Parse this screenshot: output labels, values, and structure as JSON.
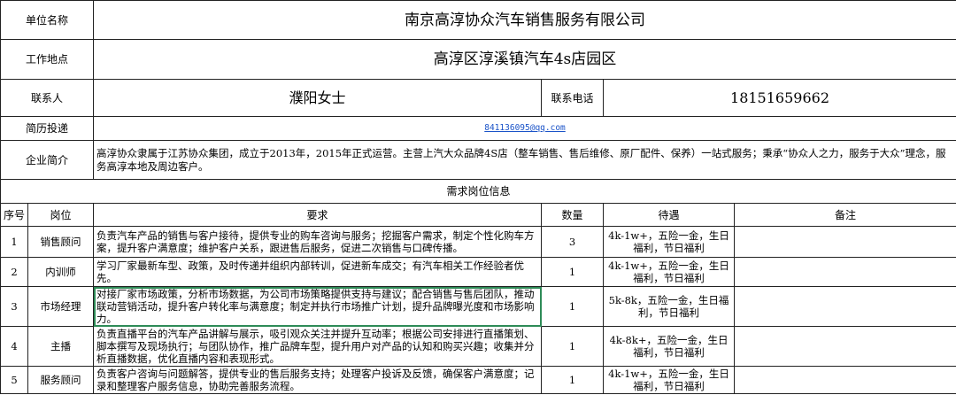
{
  "company": {
    "name_label": "单位名称",
    "name": "南京高淳协众汽车销售服务有限公司",
    "location_label": "工作地点",
    "location": "高淳区淳溪镇汽车4s店园区",
    "contact_label": "联系人",
    "contact": "濮阳女士",
    "phone_label": "联系电话",
    "phone": "18151659662",
    "resume_label": "简历投递",
    "email": "841136095@qq.com",
    "intro_label": "企业简介",
    "intro": "高淳协众隶属于江苏协众集团，成立于2013年，2015年正式运营。主营上汽大众品牌4S店（整车销售、售后维修、原厂配件、保养）一站式服务；秉承“协众人之力，服务于大众”理念，服务高淳本地及周边客户。"
  },
  "positions": {
    "section_title": "需求岗位信息",
    "headers": [
      "序号",
      "岗位",
      "要求",
      "数量",
      "待遇",
      "备注"
    ],
    "rows": [
      {
        "no": "1",
        "title": "销售顾问",
        "req": "负责汽车产品的销售与客户接待，提供专业的购车咨询与服务；挖掘客户需求，制定个性化购车方案，提升客户满意度；维护客户关系，跟进售后服务，促进二次销售与口碑传播。",
        "qty": "3",
        "pay": "4k-1w+，五险一金，生日福利，节日福利",
        "note": ""
      },
      {
        "no": "2",
        "title": "内训师",
        "req": "学习厂家最新车型、政策，及时传递并组织内部转训，促进新车成交；有汽车相关工作经验者优先。",
        "qty": "1",
        "pay": "4k-1w+，五险一金，生日福利，节日福利",
        "note": ""
      },
      {
        "no": "3",
        "title": "市场经理",
        "req": "对接厂家市场政策，分析市场数据，为公司市场策略提供支持与建议；配合销售与售后团队，推动联动营销活动，提升客户转化率与满意度；制定并执行市场推广计划，提升品牌曝光度和市场影响力。",
        "qty": "1",
        "pay": "5k-8k，五险一金，生日福利，节日福利",
        "note": ""
      },
      {
        "no": "4",
        "title": "主播",
        "req": "负责直播平台的汽车产品讲解与展示，吸引观众关注并提升互动率；根据公司安排进行直播策划、脚本撰写及现场执行；与团队协作，推广品牌车型，提升用户对产品的认知和购买兴趣；收集并分析直播数据，优化直播内容和表现形式。",
        "qty": "1",
        "pay": "4k-8k+，五险一金，生日福利，节日福利",
        "note": ""
      },
      {
        "no": "5",
        "title": "服务顾问",
        "req": "负责客户咨询与问题解答，提供专业的售后服务支持；处理客户投诉及反馈，确保客户满意度；记录和整理客户服务信息，协助完善服务流程。",
        "qty": "1",
        "pay": "4k-1w+，五险一金，生日福利，节日福利",
        "note": ""
      }
    ]
  }
}
